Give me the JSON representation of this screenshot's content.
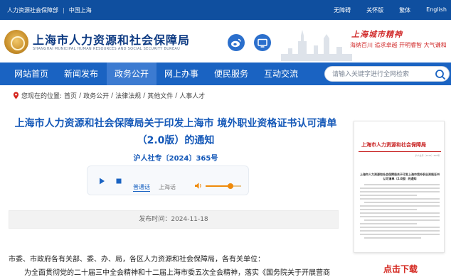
{
  "topbar": {
    "links": [
      "人力资源社会保障部",
      "中国上海"
    ],
    "separator": "|",
    "tools": [
      "无障碍",
      "关怀版",
      "繁体",
      "English"
    ]
  },
  "header": {
    "site_title": "上海市人力资源和社会保障局",
    "site_subtitle": "SHANGHAI MUNICIPAL HUMAN RESOURCES AND SOCIAL SECURITY BUREAU",
    "slogan_title": "上海城市精神",
    "slogan_words": "海纳百川  追求卓越  开明睿智  大气谦和",
    "weibo_icon": "weibo-icon",
    "tv_icon": "tv-icon"
  },
  "nav": {
    "items": [
      "网站首页",
      "新闻发布",
      "政务公开",
      "网上办事",
      "便民服务",
      "互动交流"
    ],
    "active_index": 2,
    "search_placeholder": "请输入关键字进行全网检索"
  },
  "breadcrumb": {
    "prefix": "您现在的位置:",
    "items": [
      "首页",
      "政务公开",
      "法律法规",
      "其他文件",
      "人事人才"
    ],
    "separator": "/"
  },
  "article": {
    "title": "上海市人力资源和社会保障局关于印发上海市 境外职业资格证书认可清单（2.0版）的通知",
    "doc_number": "沪人社专〔2024〕365号",
    "date": "发布时间：2024-11-18",
    "para1": "市委、市政府各有关部、委、办、局，各区人力资源和社会保障局，各有关单位：",
    "para2": "为全面贯彻党的二十届三中全会精神和十二届上海市委五次全会精神，落实《国务院关于开展营商"
  },
  "player": {
    "voice": "普通话",
    "dialect": "上海话",
    "volume": 0.7
  },
  "thumbnail": {
    "header": "上海市人力资源和社会保障局",
    "doc_number": "沪人社专〔2024〕365号",
    "title": "上海市人力资源和社会保障局关于印发上海市境外职业资格证书认可清单（2.0版）的通知"
  },
  "download_label": "点击下载",
  "colors": {
    "topbar": "#0f4f9f",
    "nav": "#1a63c2",
    "title_blue": "#1458b8",
    "red": "#d4261e",
    "volume_orange": "#f08a0a"
  }
}
